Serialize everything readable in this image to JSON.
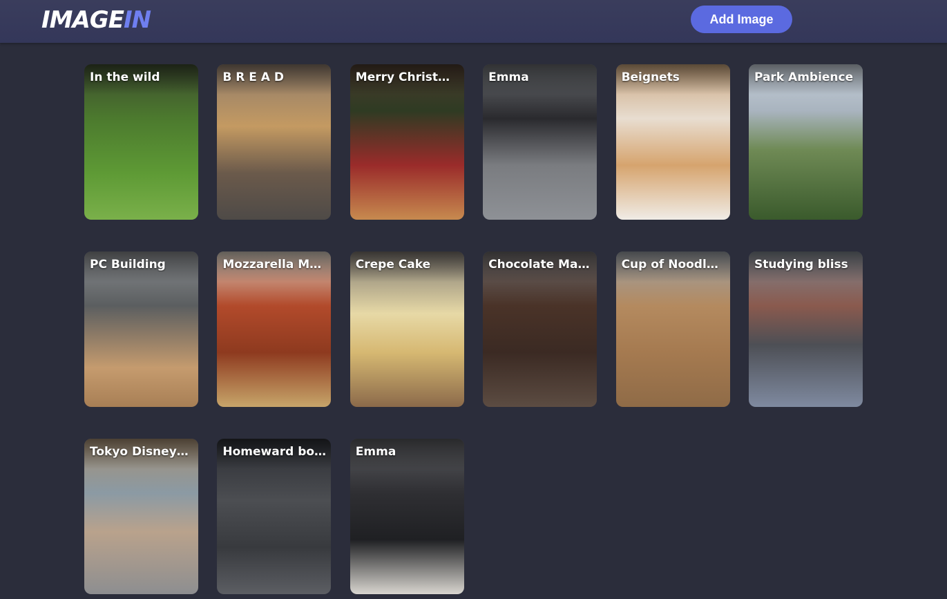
{
  "header": {
    "logo_main": "IMAGE",
    "logo_accent": "IN",
    "add_button_label": "Add Image"
  },
  "cards": [
    {
      "title": "In the wild"
    },
    {
      "title": "B R E A D"
    },
    {
      "title": "Merry Christmas!"
    },
    {
      "title": "Emma"
    },
    {
      "title": "Beignets"
    },
    {
      "title": "Park Ambience"
    },
    {
      "title": "PC Building"
    },
    {
      "title": "Mozzarella Me..."
    },
    {
      "title": "Crepe Cake"
    },
    {
      "title": "Chocolate Mar..."
    },
    {
      "title": "Cup of Noodle ..."
    },
    {
      "title": "Studying bliss"
    },
    {
      "title": "Tokyo DisneySea"
    },
    {
      "title": "Homeward bou..."
    },
    {
      "title": "Emma"
    }
  ]
}
